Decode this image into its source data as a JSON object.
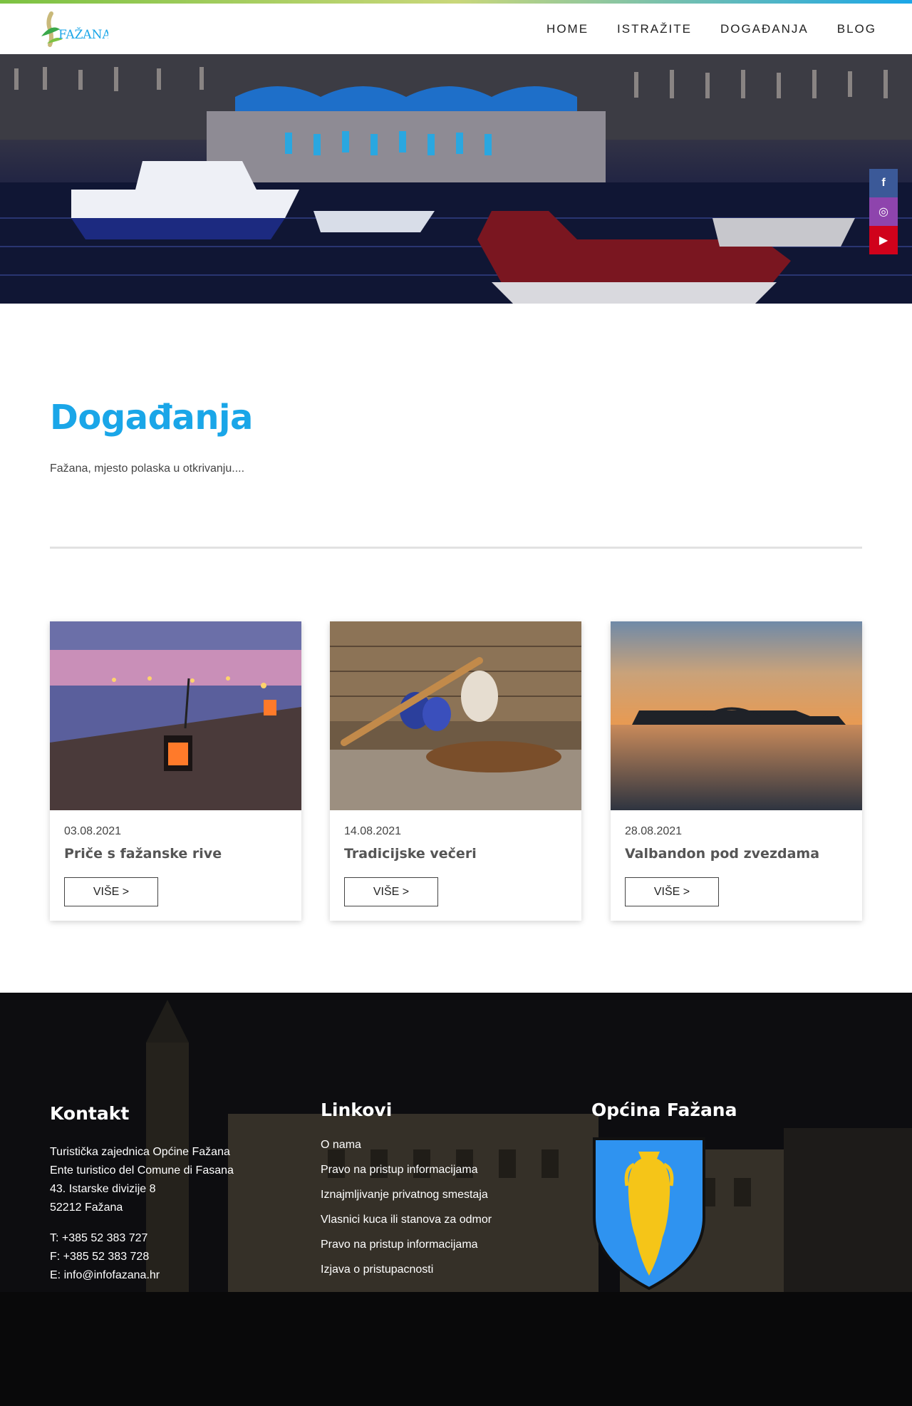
{
  "brand": {
    "logo_text": "FAŽANA"
  },
  "nav": {
    "items": [
      {
        "label": "HOME"
      },
      {
        "label": "ISTRAŽITE"
      },
      {
        "label": "DOGAĐANJA"
      },
      {
        "label": "BLOG"
      }
    ]
  },
  "social": {
    "facebook": "f",
    "instagram": "◎",
    "youtube": "▶"
  },
  "page": {
    "title": "Događanja",
    "subtitle": "Fažana, mjesto polaska u otkrivanju...."
  },
  "events": [
    {
      "date": "03.08.2021",
      "title": "Priče s fažanske rive",
      "button": "VIŠE >"
    },
    {
      "date": "14.08.2021",
      "title": "Tradicijske večeri",
      "button": "VIŠE >"
    },
    {
      "date": "28.08.2021",
      "title": "Valbandon pod zvezdama",
      "button": "VIŠE >"
    }
  ],
  "footer": {
    "contact": {
      "title": "Kontakt",
      "lines": [
        "Turistička zajednica Općine Fažana",
        "Ente turistico del Comune di Fasana",
        "43. Istarske divizije 8",
        "52212 Fažana"
      ],
      "phone": "T: +385 52 383 727",
      "fax": "F: +385 52 383 728",
      "email": "E: info@infofazana.hr"
    },
    "links": {
      "title": "Linkovi",
      "items": [
        "O nama",
        "Pravo na pristup informacijama",
        "Iznajmljivanje privatnog smestaja",
        "Vlasnici kuca ili stanova za odmor",
        "Pravo na pristup informacijama",
        "Izjava o pristupacnosti"
      ]
    },
    "municipality": {
      "title": "Općina Fažana"
    }
  },
  "colors": {
    "accent": "#1aa6e8",
    "facebook": "#3b5998",
    "instagram": "#8e44ad",
    "youtube": "#d0021b",
    "shield_blue": "#2f93f0",
    "amphora_yellow": "#f5c518"
  }
}
